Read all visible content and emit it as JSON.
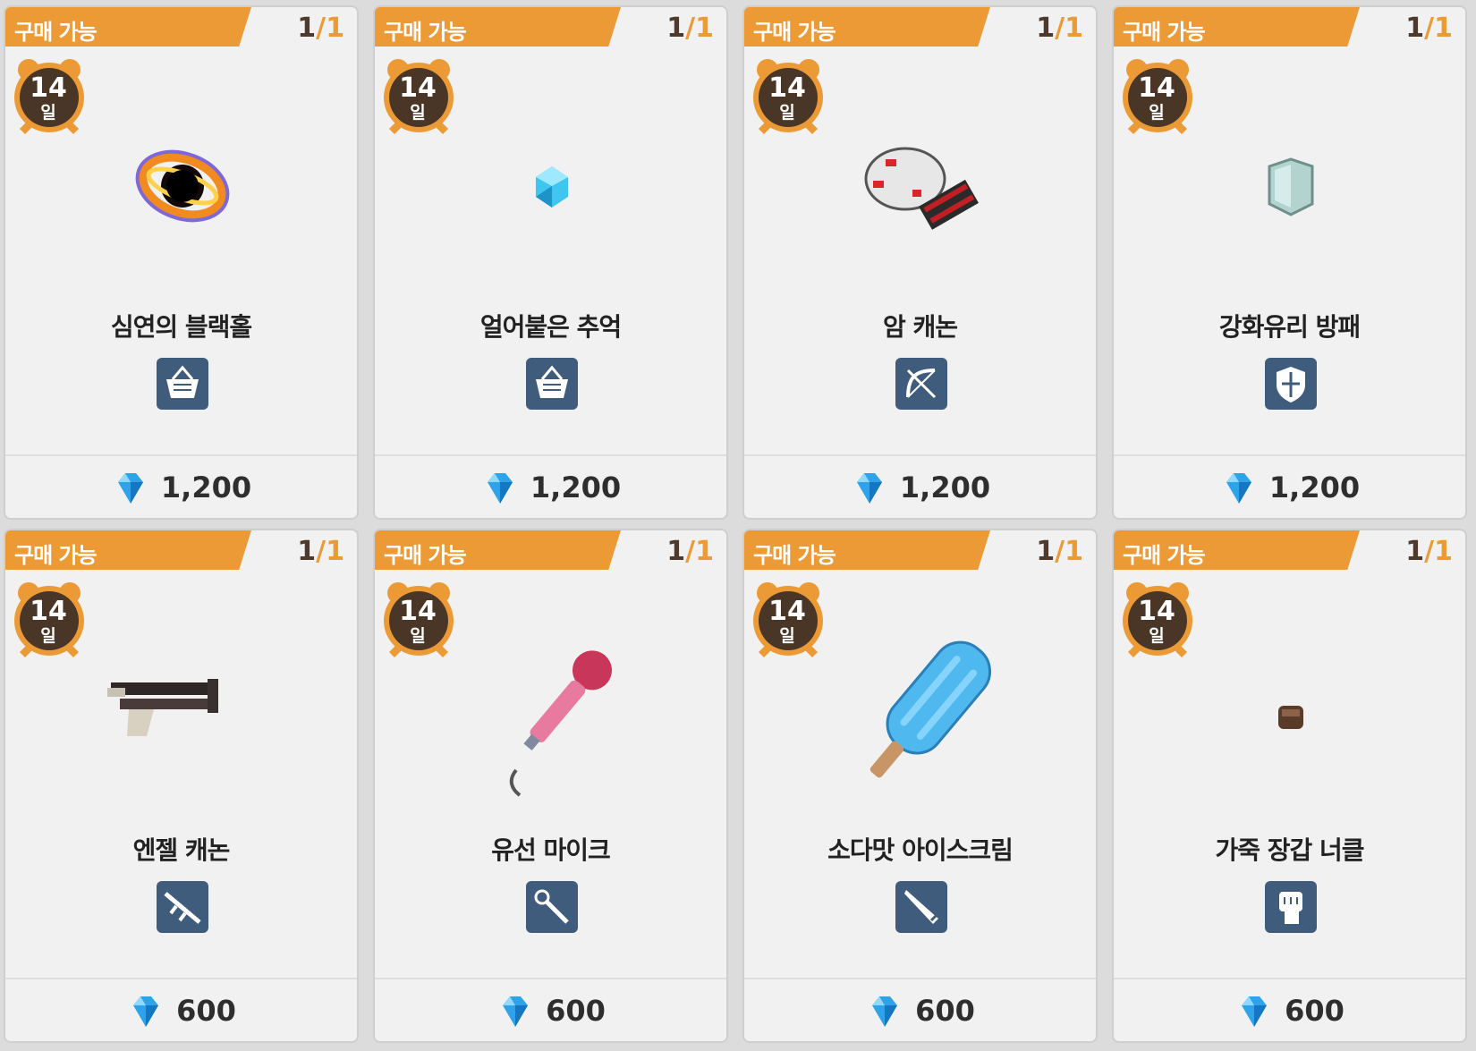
{
  "shop": {
    "items": [
      {
        "status": "구매 가능",
        "count": "1",
        "max": "1",
        "sep": "/",
        "days": "14",
        "unit": "일",
        "name": "심연의 블랙홀",
        "image": "black-hole",
        "type_icon": "basket-icon",
        "currency_icon": "diamond-icon",
        "price": "1,200"
      },
      {
        "status": "구매 가능",
        "count": "1",
        "max": "1",
        "sep": "/",
        "days": "14",
        "unit": "일",
        "name": "얼어붙은 추억",
        "image": "ice-gem",
        "type_icon": "basket-icon",
        "currency_icon": "diamond-icon",
        "price": "1,200"
      },
      {
        "status": "구매 가능",
        "count": "1",
        "max": "1",
        "sep": "/",
        "days": "14",
        "unit": "일",
        "name": "암 캐논",
        "image": "arm-cannon",
        "type_icon": "bow-icon",
        "currency_icon": "diamond-icon",
        "price": "1,200"
      },
      {
        "status": "구매 가능",
        "count": "1",
        "max": "1",
        "sep": "/",
        "days": "14",
        "unit": "일",
        "name": "강화유리 방패",
        "image": "glass-shield",
        "type_icon": "shield-icon",
        "currency_icon": "diamond-icon",
        "price": "1,200"
      },
      {
        "status": "구매 가능",
        "count": "1",
        "max": "1",
        "sep": "/",
        "days": "14",
        "unit": "일",
        "name": "엔젤 캐논",
        "image": "angel-cannon",
        "type_icon": "rifle-icon",
        "currency_icon": "diamond-icon",
        "price": "600"
      },
      {
        "status": "구매 가능",
        "count": "1",
        "max": "1",
        "sep": "/",
        "days": "14",
        "unit": "일",
        "name": "유선 마이크",
        "image": "microphone",
        "type_icon": "staff-icon",
        "currency_icon": "diamond-icon",
        "price": "600"
      },
      {
        "status": "구매 가능",
        "count": "1",
        "max": "1",
        "sep": "/",
        "days": "14",
        "unit": "일",
        "name": "소다맛 아이스크림",
        "image": "popsicle",
        "type_icon": "sword-icon",
        "currency_icon": "diamond-icon",
        "price": "600"
      },
      {
        "status": "구매 가능",
        "count": "1",
        "max": "1",
        "sep": "/",
        "days": "14",
        "unit": "일",
        "name": "가죽 장갑 너클",
        "image": "knuckle",
        "type_icon": "fist-icon",
        "currency_icon": "diamond-icon",
        "price": "600"
      }
    ]
  },
  "colors": {
    "banner": "#eb9a35",
    "type_icon_bg": "#3f5c7c",
    "card_bg": "#f1f1f1",
    "count_current": "#4d3a2c",
    "alarm_face": "#4a3626"
  }
}
